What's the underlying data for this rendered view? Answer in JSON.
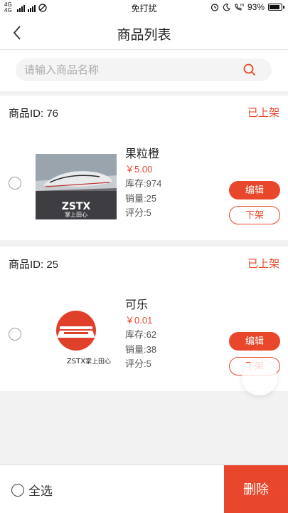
{
  "statusbar": {
    "network": "4G 4G",
    "dnd_label": "免打扰",
    "battery": "93%"
  },
  "navbar": {
    "title": "商品列表"
  },
  "search": {
    "placeholder": "请输入商品名称"
  },
  "products": [
    {
      "id_label": "商品ID: 76",
      "status": "已上架",
      "name": "果粒橙",
      "price": "￥5.00",
      "stock": "库存:974",
      "sales": "销量:25",
      "rating": "评分:5",
      "edit_label": "编辑",
      "off_label": "下架",
      "logo_text": "ZSTX",
      "logo_sub": "掌上田心"
    },
    {
      "id_label": "商品ID: 25",
      "status": "已上架",
      "name": "可乐",
      "price": "￥0.01",
      "stock": "库存:62",
      "sales": "销量:38",
      "rating": "评分:5",
      "edit_label": "编辑",
      "off_label": "下架",
      "logo_text": "ZSTX",
      "logo_sub": "掌上田心"
    }
  ],
  "bottombar": {
    "select_all_label": "全选",
    "delete_label": "删除"
  },
  "colors": {
    "accent": "#e8472b"
  }
}
